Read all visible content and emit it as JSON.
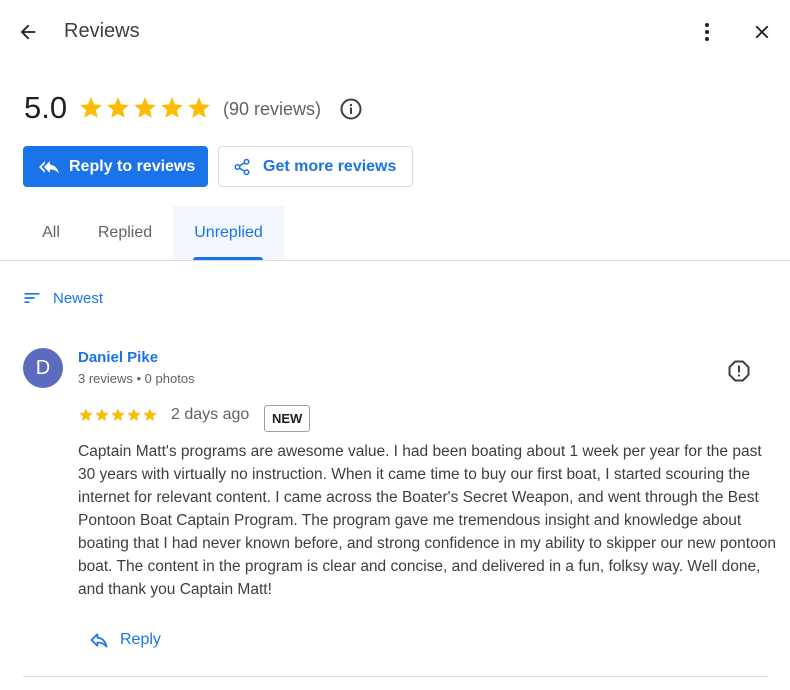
{
  "header": {
    "title": "Reviews",
    "back_icon": "arrow-back-icon",
    "more_icon": "more-vert-icon",
    "close_icon": "close-icon"
  },
  "rating": {
    "value": "5.0",
    "stars": 5,
    "count_label": "(90 reviews)",
    "info_icon": "info-icon",
    "star_color": "#fbbc04"
  },
  "actions": {
    "reply_label": "Reply to reviews",
    "reply_icon": "reply-all-icon",
    "get_more_label": "Get more reviews",
    "share_icon": "share-icon",
    "primary_color": "#1a73e8"
  },
  "tabs": [
    {
      "label": "All",
      "active": false
    },
    {
      "label": "Replied",
      "active": false
    },
    {
      "label": "Unreplied",
      "active": true
    }
  ],
  "sort": {
    "label": "Newest",
    "icon": "sort-icon"
  },
  "reviews": [
    {
      "avatar_initial": "D",
      "avatar_color": "#5c6bc0",
      "name": "Daniel Pike",
      "meta": "3 reviews • 0 photos",
      "stars": 5,
      "date": "2 days ago",
      "badge": "NEW",
      "text": "Captain Matt's programs are awesome value. I had been boating about 1 week per year for the past 30 years with virtually no instruction. When it came time to buy our first boat, I started scouring the internet for relevant content. I came across the Boater's Secret Weapon, and went through the Best Pontoon Boat Captain Program. The program gave me tremendous insight and knowledge about boating that I had never known before, and strong confidence in my ability to skipper our new pontoon boat. The content in the program is clear and concise, and delivered in a fun, folksy way. Well done, and thank you Captain Matt!",
      "reply_label": "Reply",
      "report_icon": "report-icon"
    }
  ]
}
